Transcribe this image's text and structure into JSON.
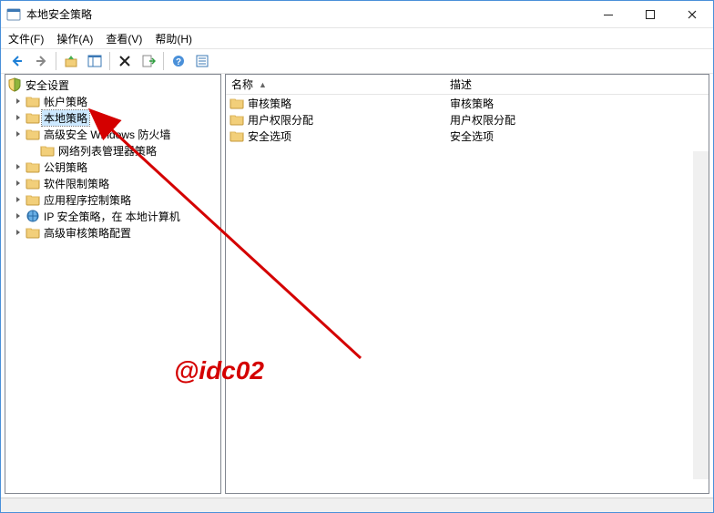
{
  "title": "本地安全策略",
  "menu": {
    "file": "文件(F)",
    "action": "操作(A)",
    "view": "查看(V)",
    "help": "帮助(H)"
  },
  "tree": {
    "root": "安全设置",
    "items": [
      {
        "label": "帐户策略",
        "expandable": true
      },
      {
        "label": "本地策略",
        "expandable": true,
        "selected": true
      },
      {
        "label": "高级安全 Windows 防火墙",
        "expandable": true
      },
      {
        "label": "网络列表管理器策略",
        "expandable": false,
        "indent": true
      },
      {
        "label": "公钥策略",
        "expandable": true
      },
      {
        "label": "软件限制策略",
        "expandable": true
      },
      {
        "label": "应用程序控制策略",
        "expandable": true
      },
      {
        "label": "IP 安全策略，在 本地计算机",
        "expandable": true,
        "icon": "globe"
      },
      {
        "label": "高级审核策略配置",
        "expandable": true
      }
    ]
  },
  "list": {
    "columns": {
      "name": "名称",
      "desc": "描述"
    },
    "rows": [
      {
        "name": "审核策略",
        "desc": "审核策略"
      },
      {
        "name": "用户权限分配",
        "desc": "用户权限分配"
      },
      {
        "name": "安全选项",
        "desc": "安全选项"
      }
    ]
  },
  "watermark": "@idc02"
}
